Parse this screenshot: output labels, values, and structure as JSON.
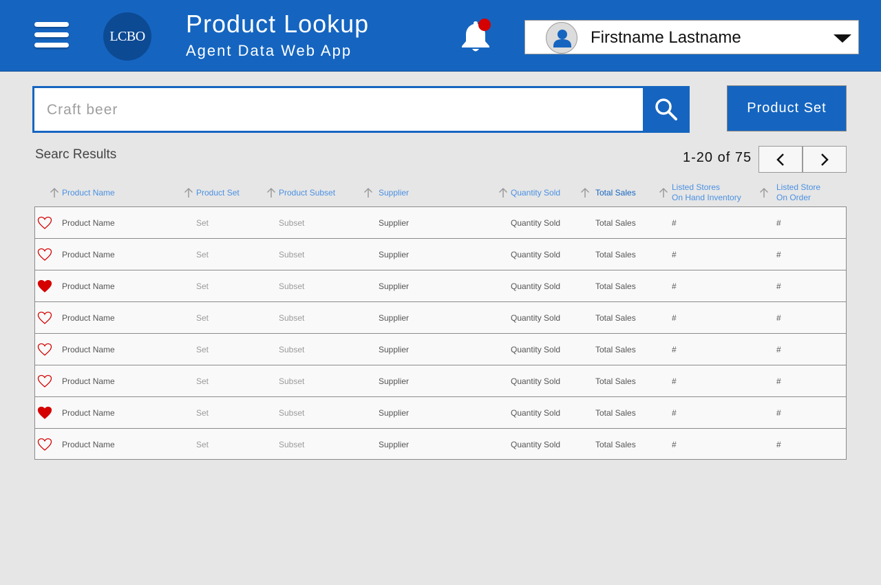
{
  "header": {
    "logo_text": "LCBO",
    "title": "Product Lookup",
    "subtitle": "Agent Data Web App",
    "user_name": "Firstname Lastname",
    "menu_icon": "hamburger-icon",
    "notification_icon": "bell-icon",
    "avatar_icon": "user-icon",
    "dropdown_icon": "caret-down-icon"
  },
  "search": {
    "placeholder": "Craft beer",
    "value": "",
    "button_icon": "search-icon"
  },
  "product_set_button": "Product Set",
  "results": {
    "title": "Searc Results",
    "pager_text": "1-20 of 75"
  },
  "columns": [
    {
      "line1": "Product Name",
      "line2": ""
    },
    {
      "line1": "Product Set",
      "line2": ""
    },
    {
      "line1": "Product Subset",
      "line2": ""
    },
    {
      "line1": "Supplier",
      "line2": ""
    },
    {
      "line1": "Quantity Sold",
      "line2": ""
    },
    {
      "line1": "Total Sales",
      "line2": ""
    },
    {
      "line1": "Listed Stores",
      "line2": "On Hand Inventory"
    },
    {
      "line1": "Listed Store",
      "line2": "On Order"
    }
  ],
  "rows": [
    {
      "favorite": false,
      "product": "Product Name",
      "set": "Set",
      "subset": "Subset",
      "supplier": "Supplier",
      "qty": "Quantity Sold",
      "sales": "Total Sales",
      "on_hand": "#",
      "on_order": "#"
    },
    {
      "favorite": false,
      "product": "Product Name",
      "set": "Set",
      "subset": "Subset",
      "supplier": "Supplier",
      "qty": "Quantity Sold",
      "sales": "Total Sales",
      "on_hand": "#",
      "on_order": "#"
    },
    {
      "favorite": true,
      "product": "Product Name",
      "set": "Set",
      "subset": "Subset",
      "supplier": "Supplier",
      "qty": "Quantity Sold",
      "sales": "Total Sales",
      "on_hand": "#",
      "on_order": "#"
    },
    {
      "favorite": false,
      "product": "Product Name",
      "set": "Set",
      "subset": "Subset",
      "supplier": "Supplier",
      "qty": "Quantity Sold",
      "sales": "Total Sales",
      "on_hand": "#",
      "on_order": "#"
    },
    {
      "favorite": false,
      "product": "Product Name",
      "set": "Set",
      "subset": "Subset",
      "supplier": "Supplier",
      "qty": "Quantity Sold",
      "sales": "Total Sales",
      "on_hand": "#",
      "on_order": "#"
    },
    {
      "favorite": false,
      "product": "Product Name",
      "set": "Set",
      "subset": "Subset",
      "supplier": "Supplier",
      "qty": "Quantity Sold",
      "sales": "Total Sales",
      "on_hand": "#",
      "on_order": "#"
    },
    {
      "favorite": true,
      "product": "Product Name",
      "set": "Set",
      "subset": "Subset",
      "supplier": "Supplier",
      "qty": "Quantity Sold",
      "sales": "Total Sales",
      "on_hand": "#",
      "on_order": "#"
    },
    {
      "favorite": false,
      "product": "Product Name",
      "set": "Set",
      "subset": "Subset",
      "supplier": "Supplier",
      "qty": "Quantity Sold",
      "sales": "Total Sales",
      "on_hand": "#",
      "on_order": "#"
    }
  ],
  "colors": {
    "brand_blue": "#1565c0",
    "header_link": "#4a90e2",
    "favorite_red": "#d50000",
    "background": "#e6e6e6"
  }
}
